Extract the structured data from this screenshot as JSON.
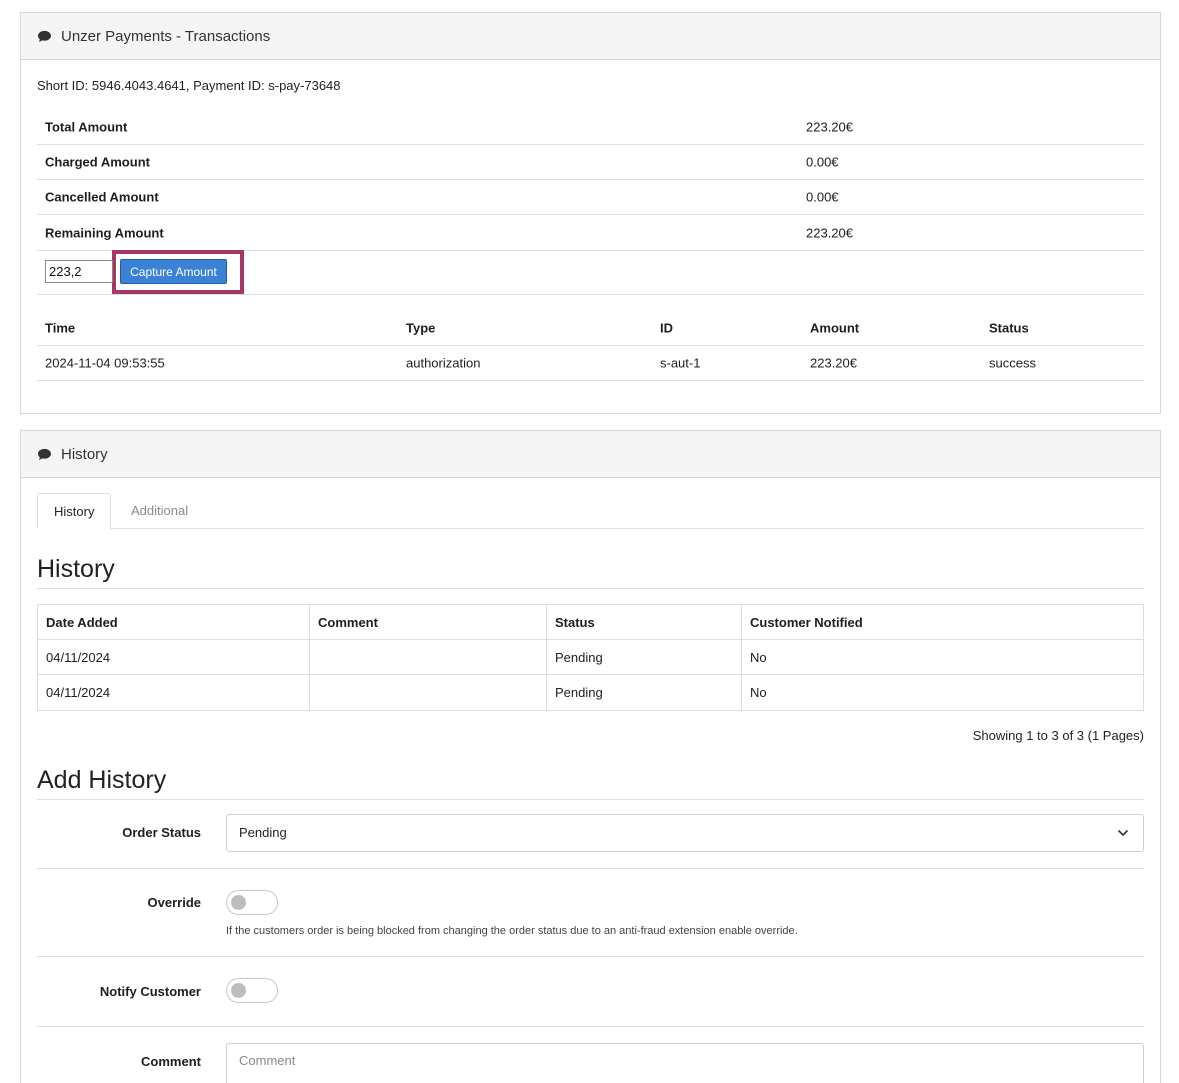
{
  "transactions_panel": {
    "title": "Unzer Payments - Transactions",
    "ids_line": "Short ID: 5946.4043.4641, Payment ID: s-pay-73648",
    "amounts": [
      {
        "label": "Total Amount",
        "value": "223.20€"
      },
      {
        "label": "Charged Amount",
        "value": "0.00€"
      },
      {
        "label": "Cancelled Amount",
        "value": "0.00€"
      },
      {
        "label": "Remaining Amount",
        "value": "223.20€"
      }
    ],
    "capture": {
      "input_value": "223,2",
      "button_label": "Capture Amount"
    },
    "table": {
      "headers": [
        "Time",
        "Type",
        "ID",
        "Amount",
        "Status"
      ],
      "rows": [
        [
          "2024-11-04 09:53:55",
          "authorization",
          "s-aut-1",
          "223.20€",
          "success"
        ]
      ]
    }
  },
  "history_panel": {
    "title": "History",
    "tabs": [
      "History",
      "Additional"
    ],
    "history_heading": "History",
    "table": {
      "headers": [
        "Date Added",
        "Comment",
        "Status",
        "Customer Notified"
      ],
      "rows": [
        [
          "04/11/2024",
          "",
          "Pending",
          "No"
        ],
        [
          "04/11/2024",
          "",
          "Pending",
          "No"
        ]
      ]
    },
    "pager_text": "Showing 1 to 3 of 3 (1 Pages)",
    "add_heading": "Add History",
    "form": {
      "order_status_label": "Order Status",
      "order_status_value": "Pending",
      "override_label": "Override",
      "override_on": false,
      "override_help": "If the customers order is being blocked from changing the order status due to an anti-fraud extension enable override.",
      "notify_label": "Notify Customer",
      "notify_on": false,
      "comment_label": "Comment",
      "comment_placeholder": "Comment"
    }
  },
  "colors": {
    "highlight": "#a43763",
    "button": "#3b82d6"
  }
}
